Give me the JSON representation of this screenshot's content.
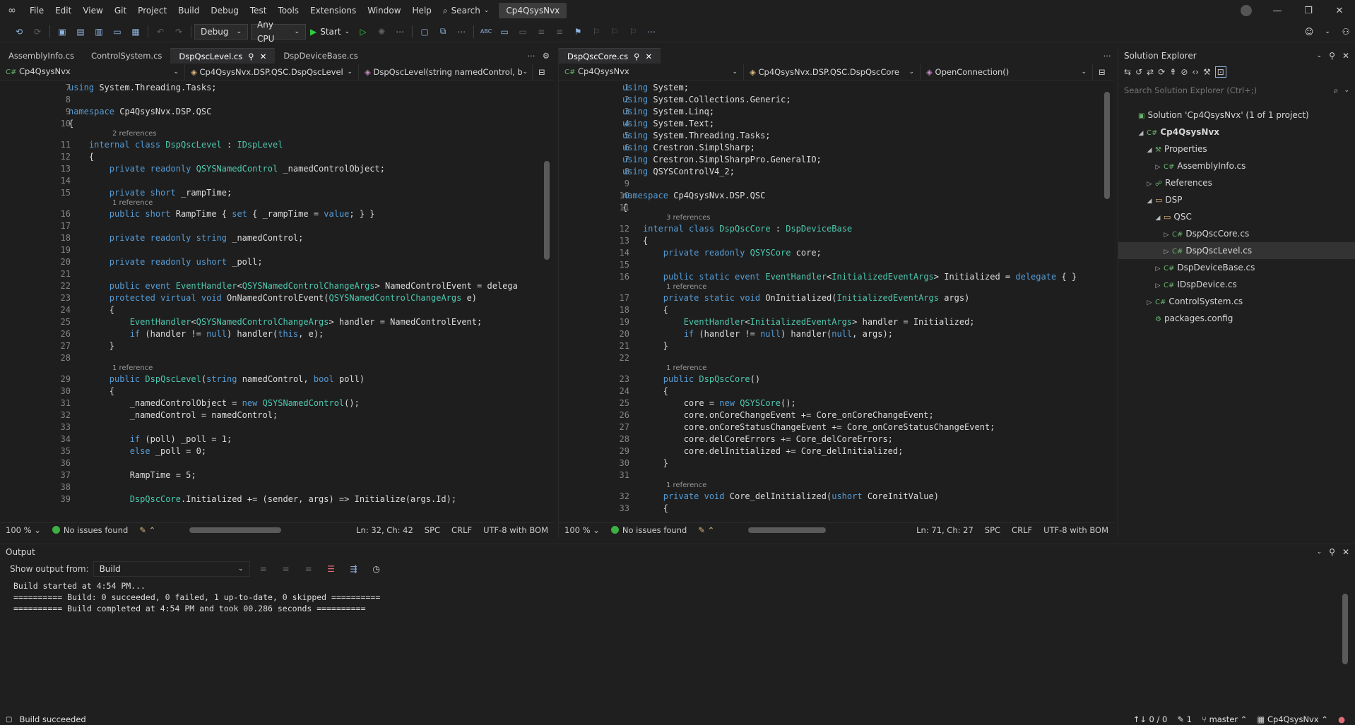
{
  "menu": {
    "items": [
      "File",
      "Edit",
      "View",
      "Git",
      "Project",
      "Build",
      "Debug",
      "Test",
      "Tools",
      "Extensions",
      "Window",
      "Help"
    ],
    "search_label": "Search",
    "solution_title": "Cp4QsysNvx"
  },
  "toolbar": {
    "configuration": "Debug",
    "platform": "Any CPU",
    "start_label": "Start"
  },
  "left_editor": {
    "tabs": [
      {
        "label": "AssemblyInfo.cs",
        "active": false
      },
      {
        "label": "ControlSystem.cs",
        "active": false
      },
      {
        "label": "DspQscLevel.cs",
        "active": true
      },
      {
        "label": "DspDeviceBase.cs",
        "active": false
      }
    ],
    "nav_project": "Cp4QsysNvx",
    "nav_class": "Cp4QsysNvx.DSP.QSC.DspQscLevel",
    "nav_member": "DspQscLevel(string namedControl, b",
    "lines": [
      {
        "n": "7",
        "code": "using System.Threading.Tasks;"
      },
      {
        "n": "8",
        "code": ""
      },
      {
        "n": "9",
        "code": "namespace Cp4QsysNvx.DSP.QSC"
      },
      {
        "n": "10",
        "code": "{"
      },
      {
        "n": "",
        "lens": "2 references"
      },
      {
        "n": "11",
        "code": "    internal class DspQscLevel : IDspLevel"
      },
      {
        "n": "12",
        "code": "    {"
      },
      {
        "n": "13",
        "code": "        private readonly QSYSNamedControl _namedControlObject;"
      },
      {
        "n": "14",
        "code": ""
      },
      {
        "n": "15",
        "code": "        private short _rampTime;"
      },
      {
        "n": "",
        "lens": "1 reference"
      },
      {
        "n": "16",
        "code": "        public short RampTime { set { _rampTime = value; } }"
      },
      {
        "n": "17",
        "code": ""
      },
      {
        "n": "18",
        "code": "        private readonly string _namedControl;"
      },
      {
        "n": "19",
        "code": ""
      },
      {
        "n": "20",
        "code": "        private readonly ushort _poll;"
      },
      {
        "n": "21",
        "code": ""
      },
      {
        "n": "22",
        "code": "        public event EventHandler<QSYSNamedControlChangeArgs> NamedControlEvent = delega"
      },
      {
        "n": "23",
        "code": "        protected virtual void OnNamedControlEvent(QSYSNamedControlChangeArgs e)"
      },
      {
        "n": "24",
        "code": "        {"
      },
      {
        "n": "25",
        "code": "            EventHandler<QSYSNamedControlChangeArgs> handler = NamedControlEvent;"
      },
      {
        "n": "26",
        "code": "            if (handler != null) handler(this, e);"
      },
      {
        "n": "27",
        "code": "        }"
      },
      {
        "n": "28",
        "code": ""
      },
      {
        "n": "",
        "lens": "1 reference"
      },
      {
        "n": "29",
        "code": "        public DspQscLevel(string namedControl, bool poll)"
      },
      {
        "n": "30",
        "code": "        {"
      },
      {
        "n": "31",
        "code": "            _namedControlObject = new QSYSNamedControl();"
      },
      {
        "n": "32",
        "code": "            _namedControl = namedControl;"
      },
      {
        "n": "33",
        "code": ""
      },
      {
        "n": "34",
        "code": "            if (poll) _poll = 1;"
      },
      {
        "n": "35",
        "code": "            else _poll = 0;"
      },
      {
        "n": "36",
        "code": ""
      },
      {
        "n": "37",
        "code": "            RampTime = 5;"
      },
      {
        "n": "38",
        "code": ""
      },
      {
        "n": "39",
        "code": "            DspQscCore.Initialized += (sender, args) => Initialize(args.Id);"
      }
    ],
    "zoom": "100 %",
    "issues": "No issues found",
    "position": "Ln: 32, Ch: 42",
    "whitespace": "SPC",
    "line_ending": "CRLF",
    "encoding": "UTF-8 with BOM"
  },
  "right_editor": {
    "tabs": [
      {
        "label": "DspQscCore.cs",
        "active": true
      }
    ],
    "nav_project": "Cp4QsysNvx",
    "nav_class": "Cp4QsysNvx.DSP.QSC.DspQscCore",
    "nav_member": "OpenConnection()",
    "lines": [
      {
        "n": "1",
        "code": "using System;"
      },
      {
        "n": "2",
        "code": "using System.Collections.Generic;"
      },
      {
        "n": "3",
        "code": "using System.Linq;"
      },
      {
        "n": "4",
        "code": "using System.Text;"
      },
      {
        "n": "5",
        "code": "using System.Threading.Tasks;"
      },
      {
        "n": "6",
        "code": "using Crestron.SimplSharp;"
      },
      {
        "n": "7",
        "code": "using Crestron.SimplSharpPro.GeneralIO;"
      },
      {
        "n": "8",
        "code": "using QSYSControlV4_2;"
      },
      {
        "n": "9",
        "code": ""
      },
      {
        "n": "10",
        "code": "namespace Cp4QsysNvx.DSP.QSC"
      },
      {
        "n": "11",
        "code": "{"
      },
      {
        "n": "",
        "lens": "3 references"
      },
      {
        "n": "12",
        "code": "    internal class DspQscCore : DspDeviceBase"
      },
      {
        "n": "13",
        "code": "    {"
      },
      {
        "n": "14",
        "code": "        private readonly QSYSCore core;"
      },
      {
        "n": "15",
        "code": ""
      },
      {
        "n": "16",
        "code": "        public static event EventHandler<InitializedEventArgs> Initialized = delegate { }"
      },
      {
        "n": "",
        "lens": "1 reference"
      },
      {
        "n": "17",
        "code": "        private static void OnInitialized(InitializedEventArgs args)"
      },
      {
        "n": "18",
        "code": "        {"
      },
      {
        "n": "19",
        "code": "            EventHandler<InitializedEventArgs> handler = Initialized;"
      },
      {
        "n": "20",
        "code": "            if (handler != null) handler(null, args);"
      },
      {
        "n": "21",
        "code": "        }"
      },
      {
        "n": "22",
        "code": ""
      },
      {
        "n": "",
        "lens": "1 reference"
      },
      {
        "n": "23",
        "code": "        public DspQscCore()"
      },
      {
        "n": "24",
        "code": "        {"
      },
      {
        "n": "25",
        "code": "            core = new QSYSCore();"
      },
      {
        "n": "26",
        "code": "            core.onCoreChangeEvent += Core_onCoreChangeEvent;"
      },
      {
        "n": "27",
        "code": "            core.onCoreStatusChangeEvent += Core_onCoreStatusChangeEvent;"
      },
      {
        "n": "28",
        "code": "            core.delCoreErrors += Core_delCoreErrors;"
      },
      {
        "n": "29",
        "code": "            core.delInitialized += Core_delInitialized;"
      },
      {
        "n": "30",
        "code": "        }"
      },
      {
        "n": "31",
        "code": ""
      },
      {
        "n": "",
        "lens": "1 reference"
      },
      {
        "n": "32",
        "code": "        private void Core_delInitialized(ushort CoreInitValue)"
      },
      {
        "n": "33",
        "code": "        {"
      }
    ],
    "zoom": "100 %",
    "issues": "No issues found",
    "position": "Ln: 71, Ch: 27",
    "whitespace": "SPC",
    "line_ending": "CRLF",
    "encoding": "UTF-8 with BOM"
  },
  "solution_explorer": {
    "title": "Solution Explorer",
    "search_placeholder": "Search Solution Explorer (Ctrl+;)",
    "items": [
      {
        "label": "Solution 'Cp4QsysNvx' (1 of 1 project)",
        "depth": 0,
        "kind": "solution",
        "expander": ""
      },
      {
        "label": "Cp4QsysNvx",
        "depth": 1,
        "kind": "project",
        "expander": "open",
        "bold": true
      },
      {
        "label": "Properties",
        "depth": 2,
        "kind": "props",
        "expander": "open"
      },
      {
        "label": "AssemblyInfo.cs",
        "depth": 3,
        "kind": "cs",
        "expander": "closed"
      },
      {
        "label": "References",
        "depth": 2,
        "kind": "refs",
        "expander": "closed"
      },
      {
        "label": "DSP",
        "depth": 2,
        "kind": "folder",
        "expander": "open"
      },
      {
        "label": "QSC",
        "depth": 3,
        "kind": "folder",
        "expander": "open"
      },
      {
        "label": "DspQscCore.cs",
        "depth": 4,
        "kind": "cs",
        "expander": "closed"
      },
      {
        "label": "DspQscLevel.cs",
        "depth": 4,
        "kind": "cs",
        "expander": "closed",
        "selected": true
      },
      {
        "label": "DspDeviceBase.cs",
        "depth": 3,
        "kind": "cs",
        "expander": "closed"
      },
      {
        "label": "IDspDevice.cs",
        "depth": 3,
        "kind": "cs",
        "expander": "closed"
      },
      {
        "label": "ControlSystem.cs",
        "depth": 2,
        "kind": "cs",
        "expander": "closed"
      },
      {
        "label": "packages.config",
        "depth": 2,
        "kind": "config",
        "expander": ""
      }
    ]
  },
  "output": {
    "title": "Output",
    "show_from_label": "Show output from:",
    "source": "Build",
    "lines": [
      "Build started at 4:54 PM...",
      "========== Build: 0 succeeded, 0 failed, 1 up-to-date, 0 skipped ==========",
      "========== Build completed at 4:54 PM and took 00.286 seconds =========="
    ]
  },
  "statusbar": {
    "message": "Build succeeded",
    "git_changes": "0 / 0",
    "pencil_count": "1",
    "branch": "master",
    "repo": "Cp4QsysNvx"
  }
}
